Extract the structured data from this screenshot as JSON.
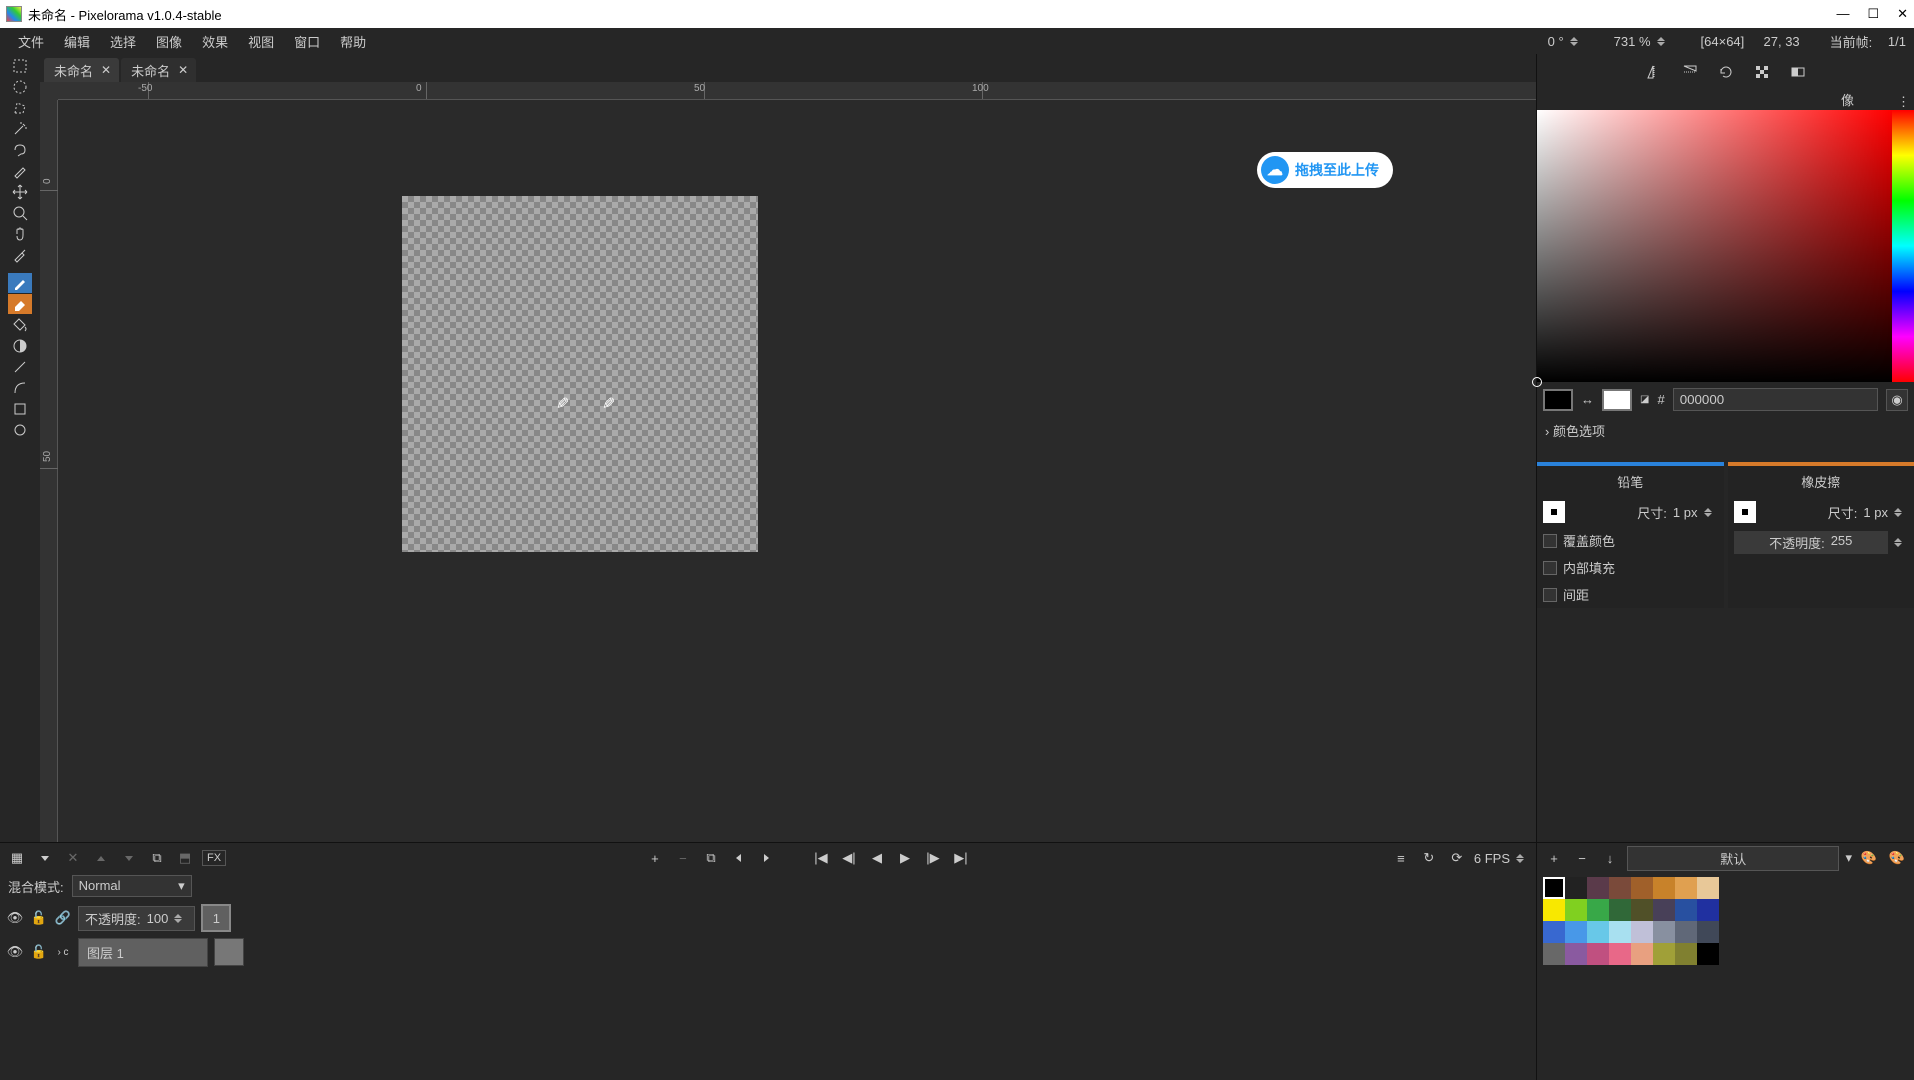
{
  "titlebar": {
    "title": "未命名 - Pixelorama v1.0.4-stable"
  },
  "menu": {
    "file": "文件",
    "edit": "编辑",
    "select": "选择",
    "image": "图像",
    "effects": "效果",
    "view": "视图",
    "window": "窗口",
    "help": "帮助"
  },
  "status": {
    "rotation": "0 °",
    "zoom": "731 %",
    "dims": "[64×64]",
    "coords": "27, 33",
    "frame_label": "当前帧:",
    "frame_value": "1/1"
  },
  "tabs": [
    {
      "name": "未命名",
      "active": true
    },
    {
      "name": "未命名",
      "active": false
    }
  ],
  "ruler": {
    "labels": [
      "-50",
      "0",
      "50",
      "100"
    ]
  },
  "upload_chip": "拖拽至此上传",
  "color": {
    "primary": "#000000",
    "secondary": "#ffffff",
    "hex": "000000",
    "options_label": "颜色选项"
  },
  "brush": {
    "pencil_title": "铅笔",
    "eraser_title": "橡皮擦",
    "size_label": "尺寸:",
    "size_value": "1 px",
    "override_label": "覆盖颜色",
    "fill_label": "内部填充",
    "spacing_label": "间距",
    "opacity_label": "不透明度:",
    "opacity_value": "255"
  },
  "timeline": {
    "fps_label": "6 FPS",
    "blend_label": "混合模式:",
    "blend_value": "Normal",
    "opacity_label": "不透明度:",
    "opacity_value": "100",
    "frame_number": "1",
    "layer_name": "图层 1",
    "fx": "FX"
  },
  "palette": {
    "name": "默认",
    "colors": [
      "#000000",
      "#222222",
      "#5a3a4a",
      "#7a4a3a",
      "#a0602a",
      "#c8822a",
      "#e0a050",
      "#e8c898",
      "#f8e800",
      "#80d020",
      "#38a848",
      "#306838",
      "#505028",
      "#484058",
      "#2850a0",
      "#2030a0",
      "#3868d0",
      "#4898e8",
      "#68c8e8",
      "#a8e0f0",
      "#c0c0d8",
      "#8890a0",
      "#606878",
      "#404858",
      "#686868",
      "#8a5aa0",
      "#c05080",
      "#e86888",
      "#e8a080",
      "#a0a038",
      "#808030",
      "#000000"
    ]
  }
}
